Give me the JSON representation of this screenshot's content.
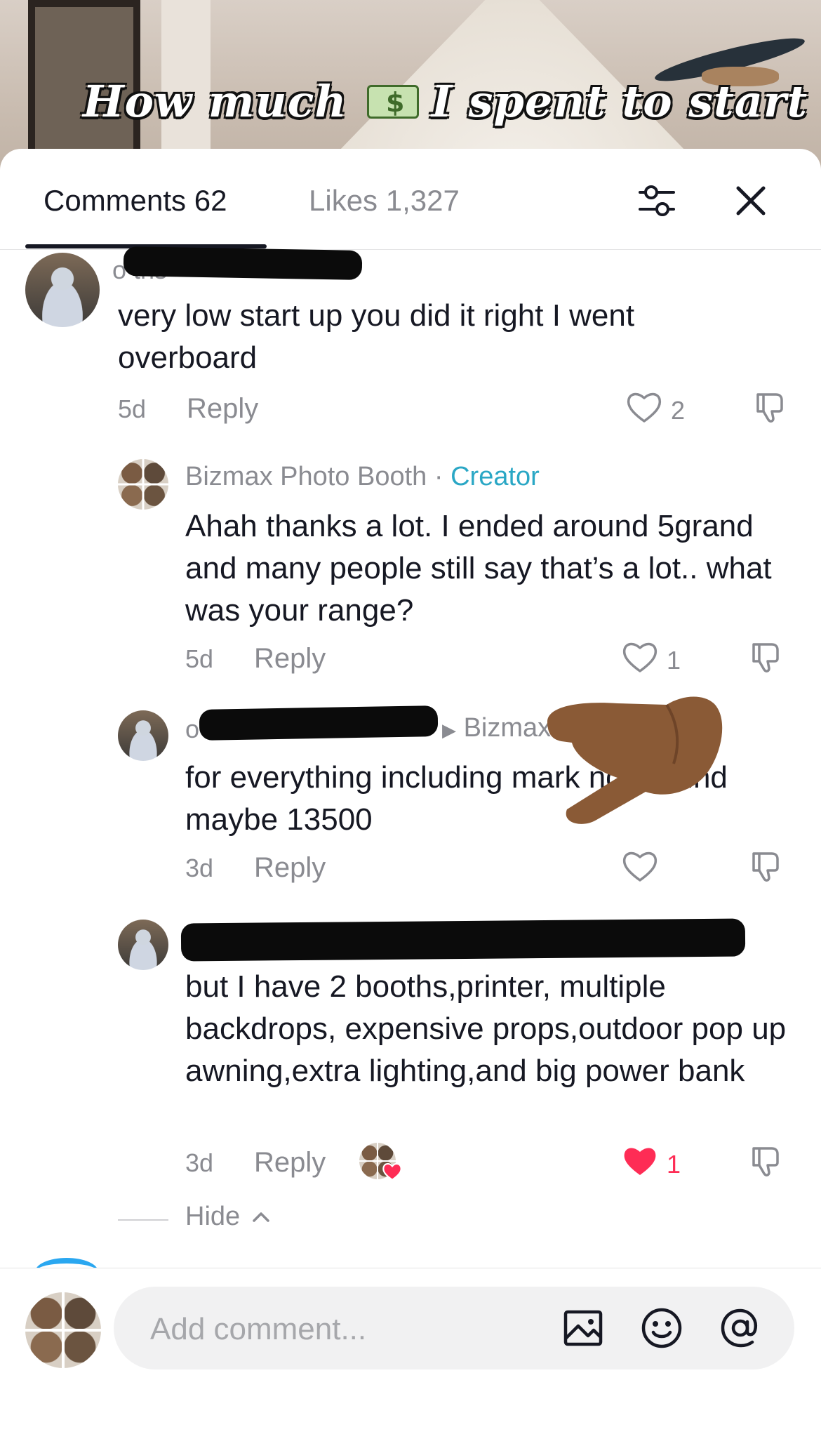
{
  "video": {
    "caption": "How much",
    "caption_rest": "I spent to start the",
    "caption_emoji": "money-with-wings-icon"
  },
  "tabs": {
    "comments_label": "Comments 62",
    "likes_label": "Likes 1,327",
    "active": "comments"
  },
  "colors": {
    "accent_creator": "#2aa7c5",
    "liked_heart": "#fe2c55",
    "muted_text": "#8a8b91"
  },
  "comments": [
    {
      "username_visible": "o ths",
      "text": "very low start up you did it right I went overboard",
      "time": "5d",
      "reply_label": "Reply",
      "likes": "2",
      "liked": false
    }
  ],
  "replies": [
    {
      "username": "Bizmax Photo Booth",
      "separator": "·",
      "badge": "Creator",
      "text": "Ahah thanks a lot. I ended around 5grand and many people still say that’s a lot.. what was your range?",
      "time": "5d",
      "reply_label": "Reply",
      "likes": "1",
      "liked": false
    },
    {
      "username_visible": "o iths",
      "reply_to": "Bizmax",
      "reply_to_tail": "h",
      "text": "for everything including mark ng around maybe 13500",
      "time": "3d",
      "reply_label": "Reply",
      "likes": "",
      "liked": false
    },
    {
      "text": "but I have 2 booths,printer, multiple backdrops, expensive props,outdoor pop up awning,extra lighting,and big power bank",
      "time": "3d",
      "reply_label": "Reply",
      "likes": "1",
      "liked": true
    }
  ],
  "thread": {
    "hide_label": "Hide"
  },
  "composer": {
    "placeholder": "Add comment...",
    "icons": [
      "image-icon",
      "emoji-icon",
      "mention-icon"
    ]
  }
}
